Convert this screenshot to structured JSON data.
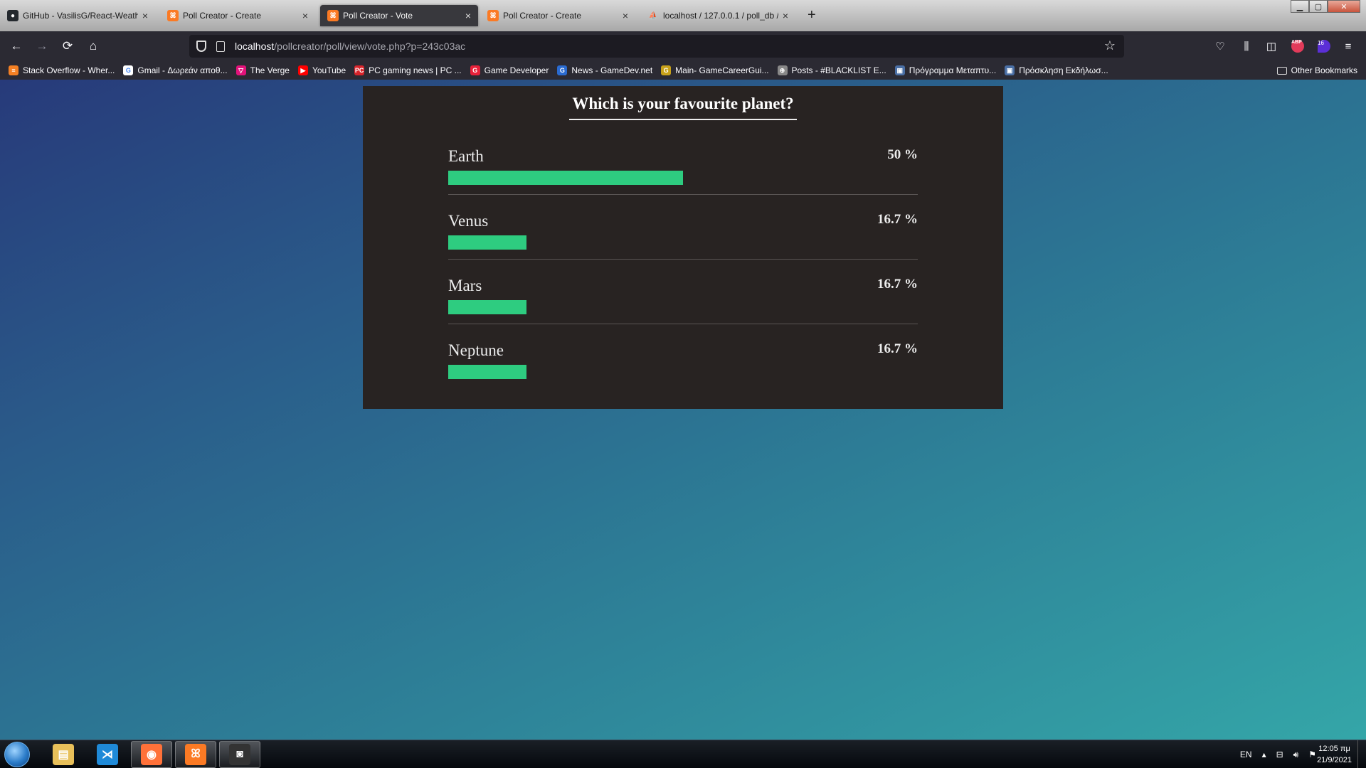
{
  "tabs": [
    {
      "title": "GitHub - VasilisG/React-Weather-",
      "favicon": "github-icon"
    },
    {
      "title": "Poll Creator - Create",
      "favicon": "xampp-icon"
    },
    {
      "title": "Poll Creator - Vote",
      "favicon": "xampp-icon"
    },
    {
      "title": "Poll Creator - Create",
      "favicon": "xampp-icon"
    },
    {
      "title": "localhost / 127.0.0.1 / poll_db / ",
      "favicon": "phpmyadmin-icon"
    }
  ],
  "active_tab": 2,
  "close_glyph": "×",
  "new_tab_glyph": "+",
  "window": {
    "minimize": "▁",
    "maximize": "▢",
    "close": "✕"
  },
  "nav": {
    "back": "←",
    "forward": "→",
    "reload": "⟳",
    "home": "⌂",
    "star": "☆",
    "abp": "ABP",
    "ext_badge": "16"
  },
  "url": {
    "host": "localhost",
    "path": "/pollcreator/poll/view/vote.php?p=243c03ac"
  },
  "bookmarks": [
    {
      "label": "Stack Overflow - Wher...",
      "color": "#f48024",
      "glyph": "≡"
    },
    {
      "label": "Gmail - Δωρεάν αποθ...",
      "color": "#ffffff",
      "glyph": "G"
    },
    {
      "label": "The Verge",
      "color": "#e2127a",
      "glyph": "▽"
    },
    {
      "label": "YouTube",
      "color": "#ff0000",
      "glyph": "▶"
    },
    {
      "label": "PC gaming news | PC ...",
      "color": "#d8232a",
      "glyph": "PC"
    },
    {
      "label": "Game Developer",
      "color": "#e8213a",
      "glyph": "G"
    },
    {
      "label": "News - GameDev.net",
      "color": "#2a6bd1",
      "glyph": "G"
    },
    {
      "label": "Main- GameCareerGui...",
      "color": "#c9a21a",
      "glyph": "G"
    },
    {
      "label": "Posts - #BLACKLIST E...",
      "color": "#888888",
      "glyph": "⊕"
    },
    {
      "label": "Πρόγραμμα Μεταπτυ...",
      "color": "#4a6fa5",
      "glyph": "▣"
    },
    {
      "label": "Πρόσκληση Εκδήλωσ...",
      "color": "#4a6fa5",
      "glyph": "▣"
    }
  ],
  "other_bookmarks": "Other Bookmarks",
  "poll": {
    "question": "Which is your favourite planet?",
    "options": [
      {
        "name": "Earth",
        "percent_label": "50 %",
        "percent": 50
      },
      {
        "name": "Venus",
        "percent_label": "16.7 %",
        "percent": 16.7
      },
      {
        "name": "Mars",
        "percent_label": "16.7 %",
        "percent": 16.7
      },
      {
        "name": "Neptune",
        "percent_label": "16.7 %",
        "percent": 16.7
      }
    ],
    "bar_color": "#2ecc80"
  },
  "taskbar": {
    "apps": [
      {
        "name": "file-explorer",
        "glyph": "▤",
        "color": "#e8c05a"
      },
      {
        "name": "vscode",
        "glyph": "⋊",
        "color": "#1f8ad8"
      },
      {
        "name": "firefox",
        "glyph": "◉",
        "color": "#ff7139"
      },
      {
        "name": "xampp",
        "glyph": "ꕤ",
        "color": "#fb7a24"
      },
      {
        "name": "camera",
        "glyph": "◙",
        "color": "#333333"
      }
    ],
    "lang": "EN",
    "time": "12:05 πμ",
    "date": "21/9/2021"
  }
}
